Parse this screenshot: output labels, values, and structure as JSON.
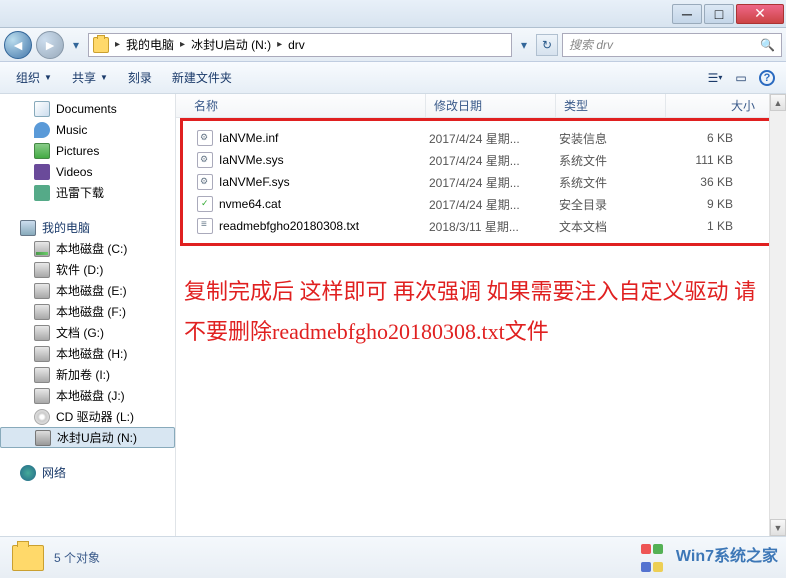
{
  "breadcrumb": {
    "root": "我的电脑",
    "drive": "冰封U启动 (N:)",
    "folder": "drv"
  },
  "search": {
    "placeholder": "搜索 drv"
  },
  "toolbar": {
    "organize": "组织",
    "share": "共享",
    "burn": "刻录",
    "newfolder": "新建文件夹"
  },
  "sidebar": {
    "library": [
      {
        "label": "Documents",
        "ico": "doc"
      },
      {
        "label": "Music",
        "ico": "music"
      },
      {
        "label": "Pictures",
        "ico": "pic"
      },
      {
        "label": "Videos",
        "ico": "vid"
      },
      {
        "label": "迅雷下载",
        "ico": "dl"
      }
    ],
    "computer_label": "我的电脑",
    "drives": [
      {
        "label": "本地磁盘 (C:)",
        "ico": "drive-c"
      },
      {
        "label": "软件 (D:)",
        "ico": "drive"
      },
      {
        "label": "本地磁盘 (E:)",
        "ico": "drive"
      },
      {
        "label": "本地磁盘 (F:)",
        "ico": "drive"
      },
      {
        "label": "文档 (G:)",
        "ico": "drive"
      },
      {
        "label": "本地磁盘 (H:)",
        "ico": "drive"
      },
      {
        "label": "新加卷 (I:)",
        "ico": "drive"
      },
      {
        "label": "本地磁盘 (J:)",
        "ico": "drive"
      },
      {
        "label": "CD 驱动器 (L:)",
        "ico": "cd"
      },
      {
        "label": "冰封U启动 (N:)",
        "ico": "usb",
        "sel": true
      }
    ],
    "network_label": "网络"
  },
  "columns": {
    "name": "名称",
    "date": "修改日期",
    "type": "类型",
    "size": "大小"
  },
  "files": [
    {
      "name": "IaNVMe.inf",
      "date": "2017/4/24 星期...",
      "type": "安装信息",
      "size": "6 KB",
      "ico": "file-inf"
    },
    {
      "name": "IaNVMe.sys",
      "date": "2017/4/24 星期...",
      "type": "系统文件",
      "size": "111 KB",
      "ico": "file-sys"
    },
    {
      "name": "IaNVMeF.sys",
      "date": "2017/4/24 星期...",
      "type": "系统文件",
      "size": "36 KB",
      "ico": "file-sys"
    },
    {
      "name": "nvme64.cat",
      "date": "2017/4/24 星期...",
      "type": "安全目录",
      "size": "9 KB",
      "ico": "file-cat"
    },
    {
      "name": "readmebfgho20180308.txt",
      "date": "2018/3/11 星期...",
      "type": "文本文档",
      "size": "1 KB",
      "ico": "file-txt"
    }
  ],
  "annotation": "复制完成后 这样即可 再次强调 如果需要注入自定义驱动 请不要删除readmebfgho20180308.txt文件",
  "status": {
    "count": "5 个对象"
  },
  "watermark": "Win7系统之家"
}
